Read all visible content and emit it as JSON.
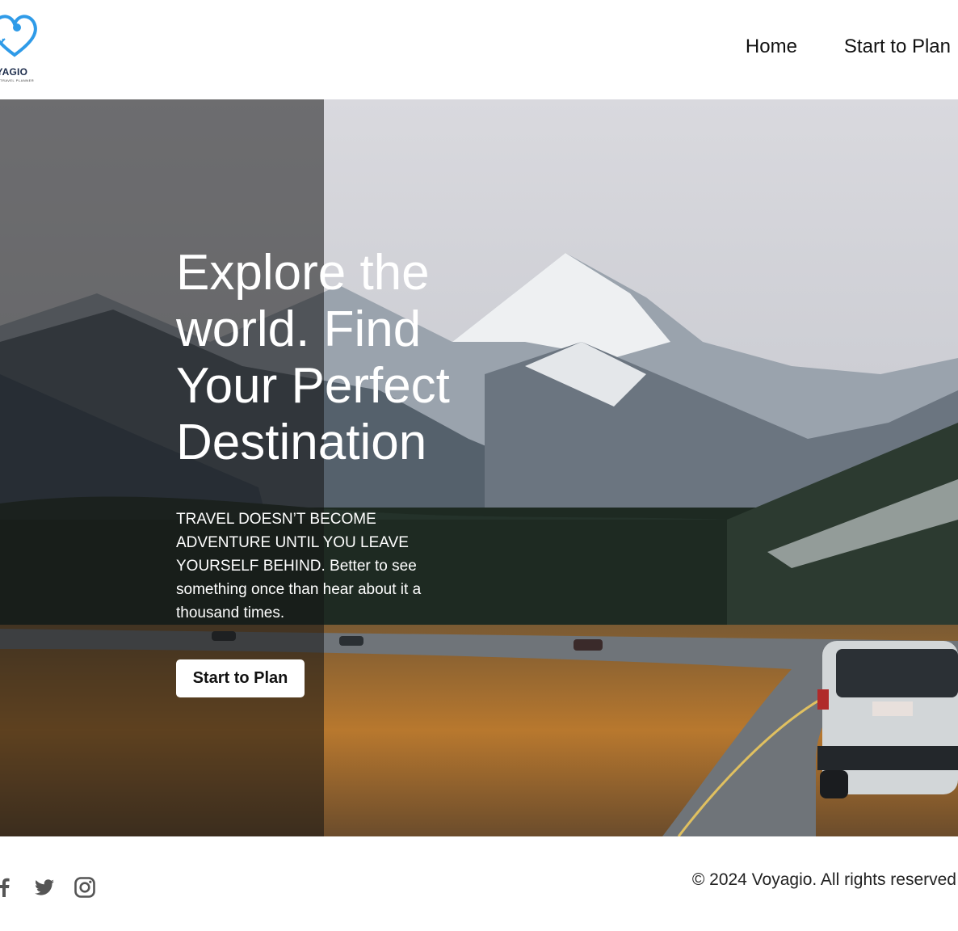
{
  "brand": {
    "name": "OYAGIO",
    "tagline": "TRAVEL PLANNER"
  },
  "nav": {
    "items": [
      {
        "label": "Home"
      },
      {
        "label": "Start to Plan"
      }
    ]
  },
  "hero": {
    "title": "Explore the world. Find Your Perfect Destination",
    "subtitle": "TRAVEL DOESN’T BECOME ADVENTURE UNTIL YOU LEAVE YOURSELF BEHIND. Better to see something once than hear about it a thousand times.",
    "cta_label": "Start to Plan"
  },
  "footer": {
    "social_icons": [
      "facebook-icon",
      "twitter-icon",
      "instagram-icon"
    ],
    "copyright": "© 2024 Voyagio. All rights reserved"
  },
  "colors": {
    "logo_blue": "#2f9be8",
    "overlay": "#141414",
    "text_dark": "#111111",
    "icon_gray": "#555555"
  }
}
